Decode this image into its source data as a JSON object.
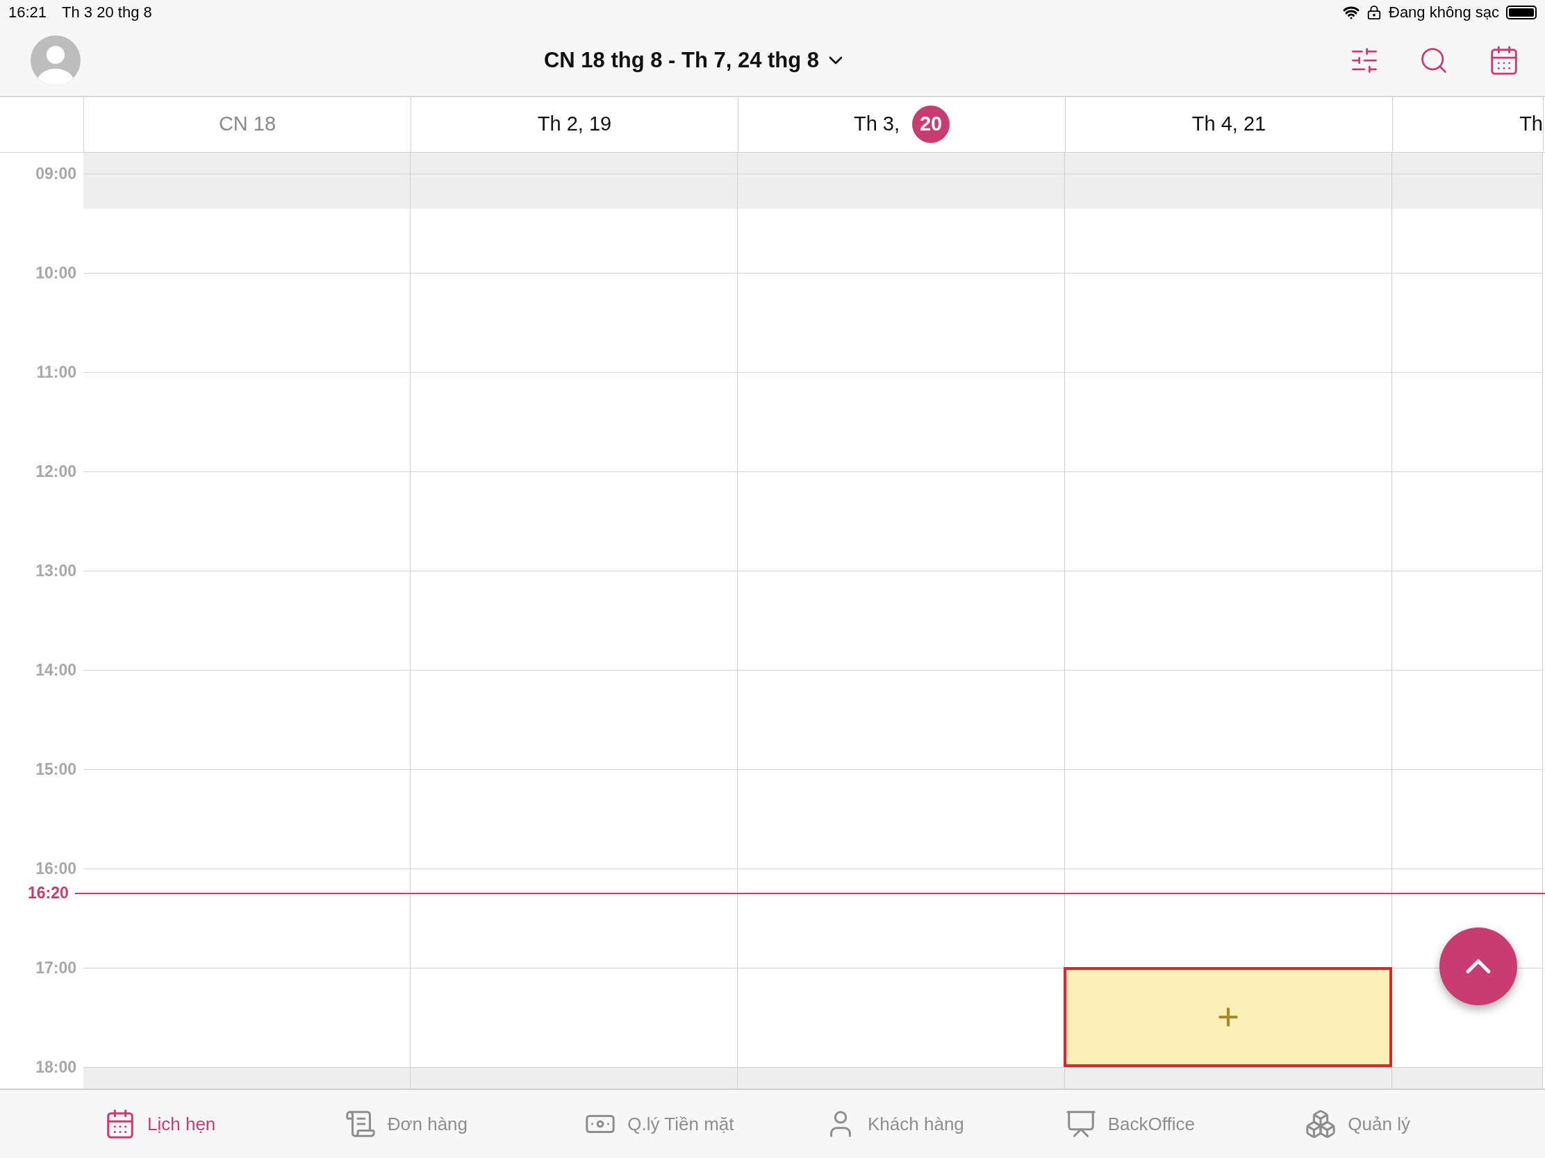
{
  "status_bar": {
    "time": "16:21",
    "date": "Th 3 20 thg 8",
    "battery_text": "Đang không sạc"
  },
  "header": {
    "range": "CN 18 thg 8 - Th 7, 24 thg 8"
  },
  "days": [
    {
      "label": "CN 18",
      "dimmed": true,
      "kind": "full"
    },
    {
      "label": "Th 2, 19",
      "dimmed": false,
      "kind": "full"
    },
    {
      "label": "Th 3,",
      "today_badge": "20",
      "dimmed": false,
      "kind": "full"
    },
    {
      "label": "Th 4, 21",
      "dimmed": false,
      "kind": "full"
    },
    {
      "label": "Th",
      "dimmed": false,
      "kind": "partial"
    }
  ],
  "hours": [
    {
      "label": "09:00"
    },
    {
      "label": "10:00"
    },
    {
      "label": "11:00"
    },
    {
      "label": "12:00"
    },
    {
      "label": "13:00"
    },
    {
      "label": "14:00"
    },
    {
      "label": "15:00"
    },
    {
      "label": "16:00",
      "now": "16:20"
    },
    {
      "label": "17:00",
      "new_slot": [
        false,
        false,
        false,
        true,
        false
      ]
    },
    {
      "label": "18:00"
    }
  ],
  "tab_bar": [
    {
      "label": "Lịch hẹn",
      "selected": true
    },
    {
      "label": "Đơn hàng",
      "selected": false
    },
    {
      "label": "Q.lý Tiền mặt",
      "selected": false
    },
    {
      "label": "Khách hàng",
      "selected": false
    },
    {
      "label": "BackOffice",
      "selected": false
    },
    {
      "label": "Quản lý",
      "selected": false
    }
  ]
}
